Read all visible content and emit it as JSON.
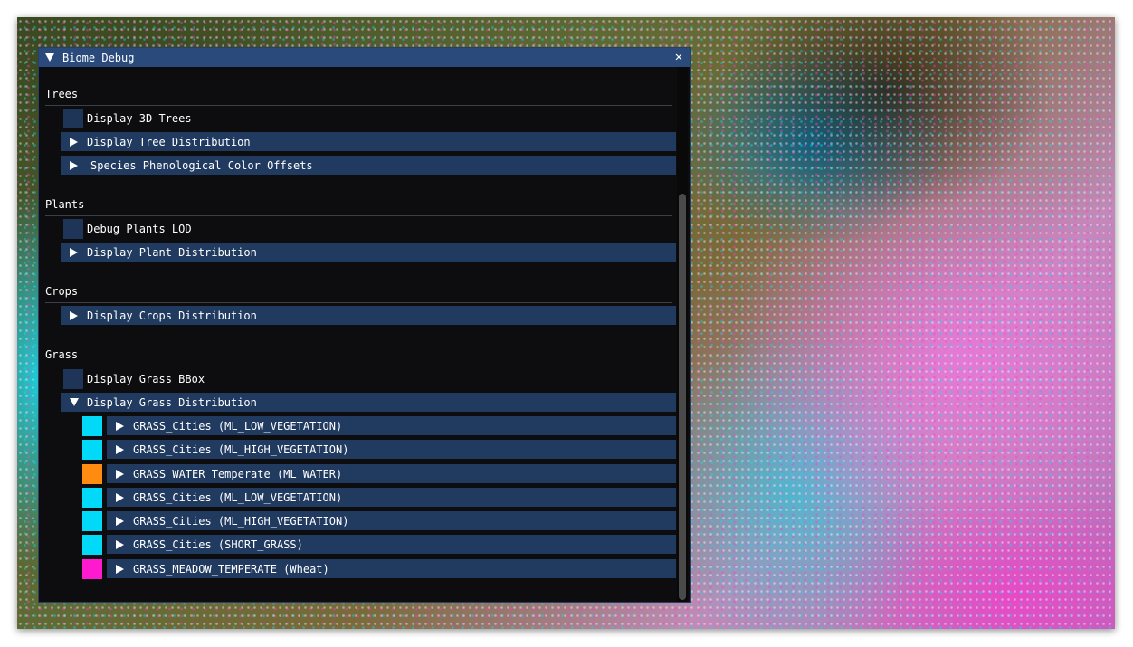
{
  "window": {
    "title": "Biome Debug",
    "close_glyph": "✕"
  },
  "trees": {
    "header": "Trees",
    "display_3d": "Display 3D Trees",
    "tree_distribution": "Display Tree Distribution",
    "phenological": "Species Phenological Color Offsets"
  },
  "plants": {
    "header": "Plants",
    "debug_lod": "Debug Plants LOD",
    "plant_distribution": "Display Plant Distribution"
  },
  "crops": {
    "header": "Crops",
    "crops_distribution": "Display Crops Distribution"
  },
  "grass": {
    "header": "Grass",
    "bbox": "Display Grass BBox",
    "grass_distribution": "Display Grass Distribution",
    "items": [
      {
        "label": "GRASS_Cities (ML_LOW_VEGETATION)",
        "color": "#00d9f8"
      },
      {
        "label": "GRASS_Cities (ML_HIGH_VEGETATION)",
        "color": "#00d9f8"
      },
      {
        "label": "GRASS_WATER_Temperate (ML_WATER)",
        "color": "#ff8c10"
      },
      {
        "label": "GRASS_Cities (ML_LOW_VEGETATION)",
        "color": "#00d9f8"
      },
      {
        "label": "GRASS_Cities (ML_HIGH_VEGETATION)",
        "color": "#00d9f8"
      },
      {
        "label": "GRASS_Cities (SHORT_GRASS)",
        "color": "#00d9f8"
      },
      {
        "label": "GRASS_MEADOW_TEMPERATE (Wheat)",
        "color": "#ff1ad0"
      }
    ]
  },
  "colors": {
    "title_bar": "#294a7a",
    "node_bg": "#203a60",
    "checkbox_bg": "#1f3558",
    "window_bg": "#0d0d0f"
  }
}
